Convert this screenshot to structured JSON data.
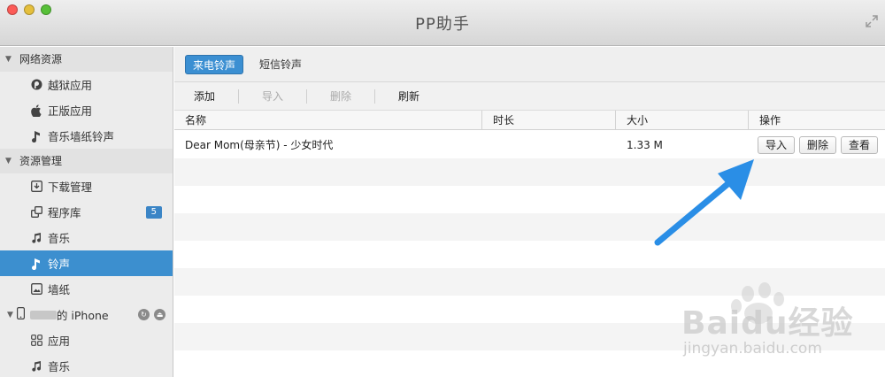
{
  "window": {
    "title": "PP助手"
  },
  "sidebar": {
    "sections": [
      {
        "label": "网络资源",
        "items": [
          {
            "label": "越狱应用",
            "icon": "pp-logo-icon"
          },
          {
            "label": "正版应用",
            "icon": "apple-icon"
          },
          {
            "label": "音乐墙纸铃声",
            "icon": "ringtone-icon"
          }
        ]
      },
      {
        "label": "资源管理",
        "items": [
          {
            "label": "下载管理",
            "icon": "download-icon"
          },
          {
            "label": "程序库",
            "icon": "apps-library-icon",
            "badge": "5"
          },
          {
            "label": "音乐",
            "icon": "music-note-icon"
          },
          {
            "label": "铃声",
            "icon": "ringtone-icon",
            "selected": true
          },
          {
            "label": "墙纸",
            "icon": "wallpaper-icon"
          }
        ]
      }
    ],
    "device": {
      "label": "的 iPhone",
      "items": [
        {
          "label": "应用",
          "icon": "apps-grid-icon"
        },
        {
          "label": "音乐",
          "icon": "music-note-icon"
        }
      ]
    }
  },
  "main": {
    "tabs": [
      {
        "label": "来电铃声",
        "active": true
      },
      {
        "label": "短信铃声",
        "active": false
      }
    ],
    "toolbar": {
      "add": "添加",
      "import": "导入",
      "delete": "删除",
      "refresh": "刷新"
    },
    "table": {
      "columns": [
        "名称",
        "时长",
        "大小",
        "操作"
      ],
      "rows": [
        {
          "name": "Dear Mom(母亲节) - 少女时代",
          "duration": "",
          "size": "1.33 M",
          "actions": [
            "导入",
            "删除",
            "查看"
          ]
        }
      ]
    }
  },
  "watermark": {
    "brand": "Baidu经验",
    "url": "jingyan.baidu.com"
  },
  "colors": {
    "accent": "#3c8fcf",
    "arrow": "#2a8ee6"
  }
}
